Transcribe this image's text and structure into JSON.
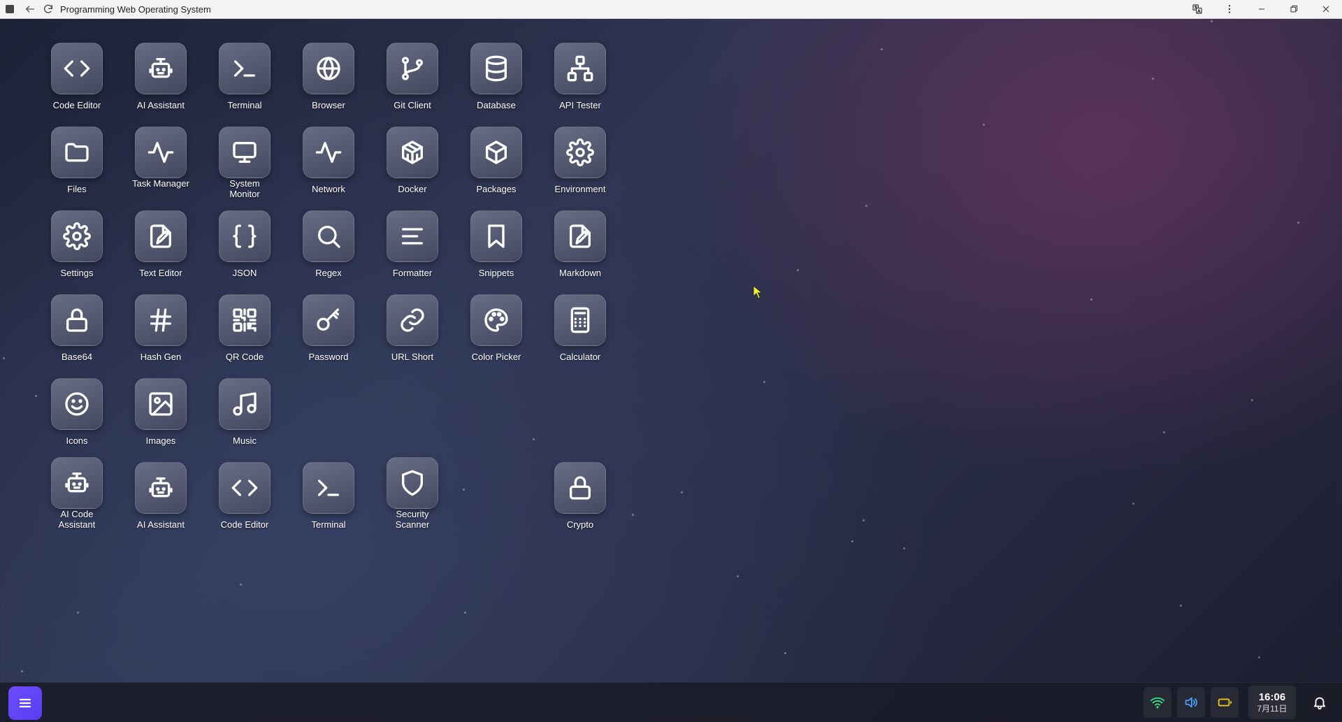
{
  "window": {
    "title": "Programming Web Operating System"
  },
  "apps": [
    {
      "label": "Code Editor",
      "icon": "code-icon"
    },
    {
      "label": "AI Assistant",
      "icon": "robot-icon"
    },
    {
      "label": "Terminal",
      "icon": "terminal-icon"
    },
    {
      "label": "Browser",
      "icon": "globe-icon"
    },
    {
      "label": "Git Client",
      "icon": "git-branch-icon"
    },
    {
      "label": "Database",
      "icon": "database-icon"
    },
    {
      "label": "API Tester",
      "icon": "network-tree-icon"
    },
    {
      "label": "Files",
      "icon": "folder-icon"
    },
    {
      "label": "Task Manager",
      "icon": "activity-icon"
    },
    {
      "label": "System Monitor",
      "icon": "monitor-icon"
    },
    {
      "label": "Network",
      "icon": "activity-icon"
    },
    {
      "label": "Docker",
      "icon": "container-icon"
    },
    {
      "label": "Packages",
      "icon": "package-icon"
    },
    {
      "label": "Environment",
      "icon": "gear-icon"
    },
    {
      "label": "Settings",
      "icon": "gear-icon"
    },
    {
      "label": "Text Editor",
      "icon": "file-edit-icon"
    },
    {
      "label": "JSON",
      "icon": "braces-icon"
    },
    {
      "label": "Regex",
      "icon": "search-icon"
    },
    {
      "label": "Formatter",
      "icon": "align-left-icon"
    },
    {
      "label": "Snippets",
      "icon": "bookmark-icon"
    },
    {
      "label": "Markdown",
      "icon": "file-edit-icon"
    },
    {
      "label": "Base64",
      "icon": "lock-icon"
    },
    {
      "label": "Hash Gen",
      "icon": "hash-icon"
    },
    {
      "label": "QR Code",
      "icon": "qr-code-icon"
    },
    {
      "label": "Password",
      "icon": "key-icon"
    },
    {
      "label": "URL Short",
      "icon": "link-icon"
    },
    {
      "label": "Color Picker",
      "icon": "palette-icon"
    },
    {
      "label": "Calculator",
      "icon": "calculator-icon"
    },
    {
      "label": "Icons",
      "icon": "smile-icon"
    },
    {
      "label": "Images",
      "icon": "image-icon"
    },
    {
      "label": "Music",
      "icon": "music-icon"
    },
    {
      "label": "AI Code Assistant",
      "icon": "robot-icon"
    },
    {
      "label": "AI Assistant",
      "icon": "robot-icon"
    },
    {
      "label": "Code Editor",
      "icon": "code-icon"
    },
    {
      "label": "Terminal",
      "icon": "terminal-icon"
    },
    {
      "label": "Security Scanner",
      "icon": "shield-icon"
    },
    {
      "label": "Crypto",
      "icon": "lock-icon"
    }
  ],
  "taskbar": {
    "start_icon": "menu-icon",
    "wifi_icon": "wifi-icon",
    "volume_icon": "volume-icon",
    "battery_icon": "battery-icon",
    "notification_icon": "bell-icon",
    "wifi_color": "#3ddc84",
    "volume_color": "#4a9dff",
    "battery_color": "#f5c518",
    "time": "16:06",
    "date": "7月11日"
  },
  "colors": {
    "start_button": "#6d4cff"
  }
}
